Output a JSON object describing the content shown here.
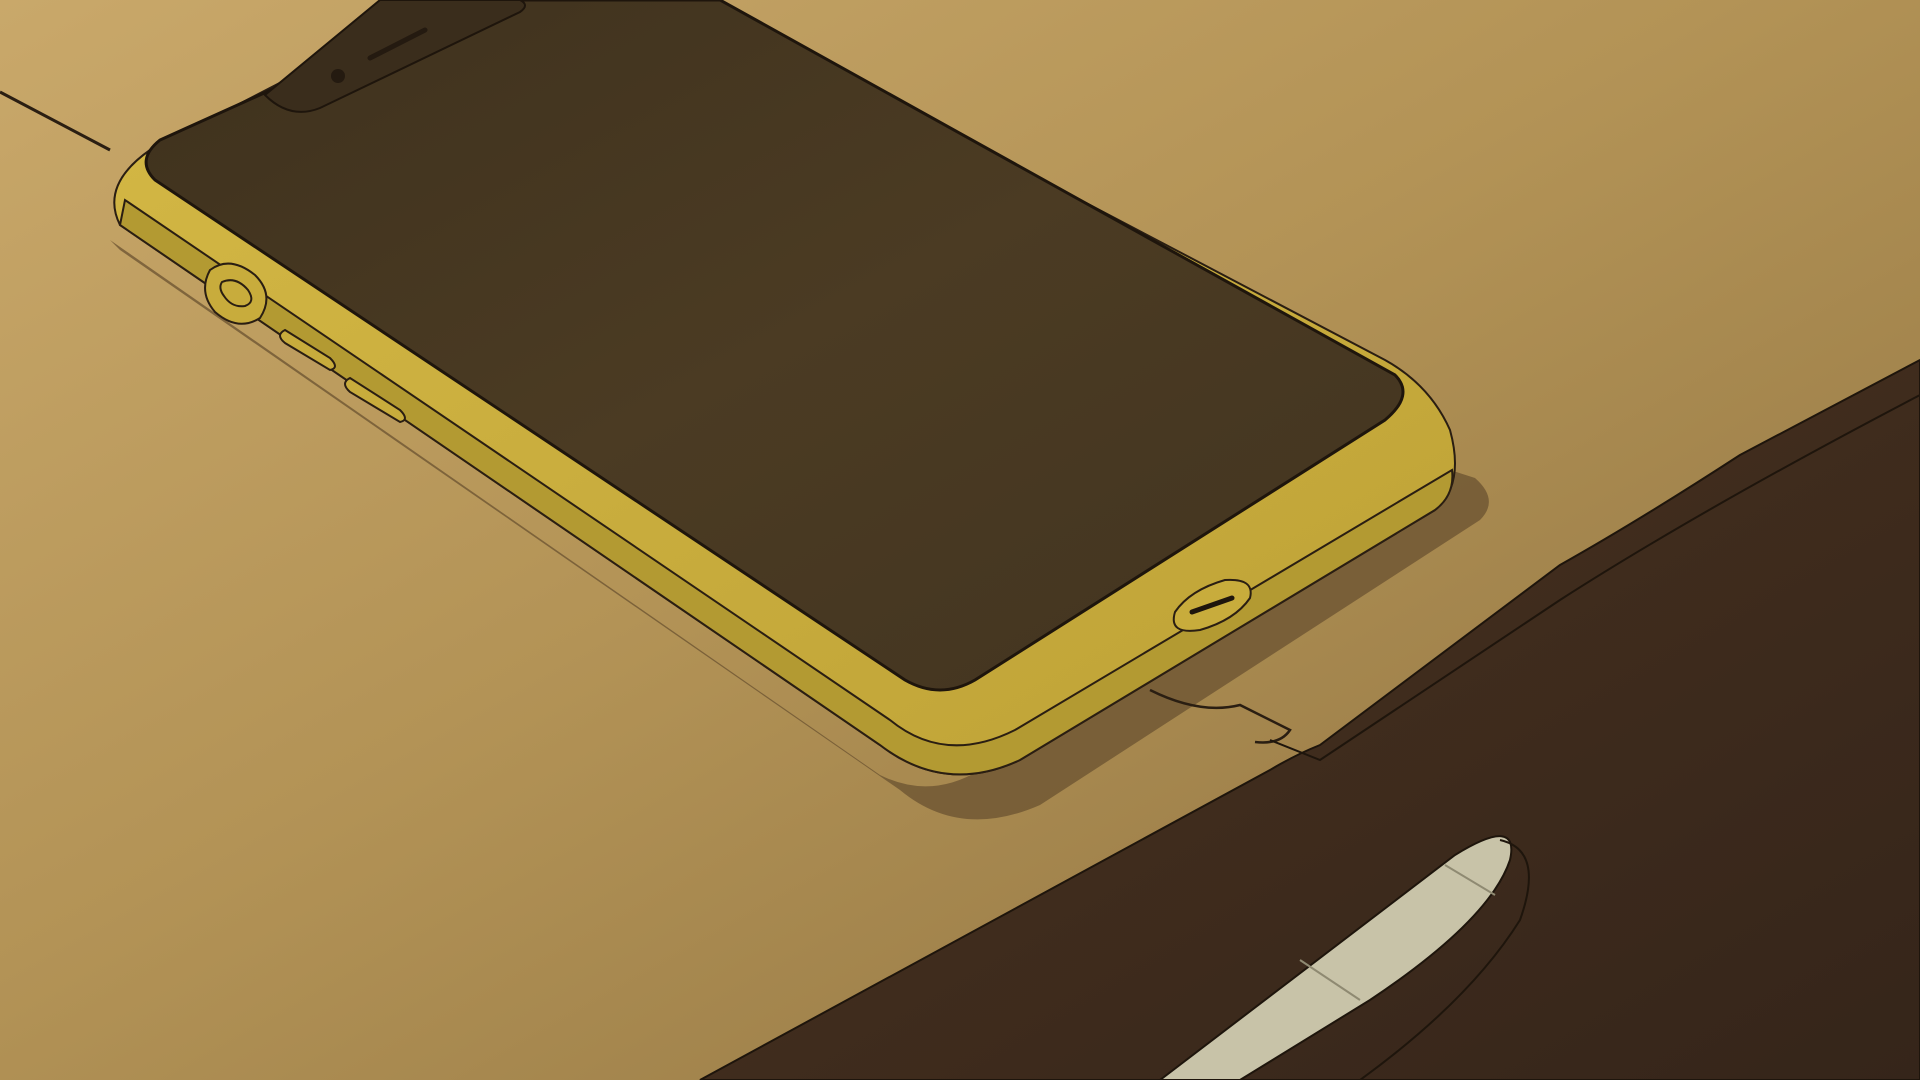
{
  "scene": {
    "subject": "smartphone-in-yellow-case-on-table",
    "palette": {
      "table_light": "#c1a064",
      "table_mid": "#a98a4f",
      "table_dark": "#8d7140",
      "phone_case": "#c8ac3c",
      "phone_case_highlight": "#d6bc48",
      "phone_case_shadow": "#a38a2c",
      "screen": "#4a3a22",
      "screen_dark": "#3a2d1c",
      "dark_object": "#3d2a1a",
      "pale_strip": "#c8c3a8",
      "outline": "#2a1e12"
    }
  }
}
